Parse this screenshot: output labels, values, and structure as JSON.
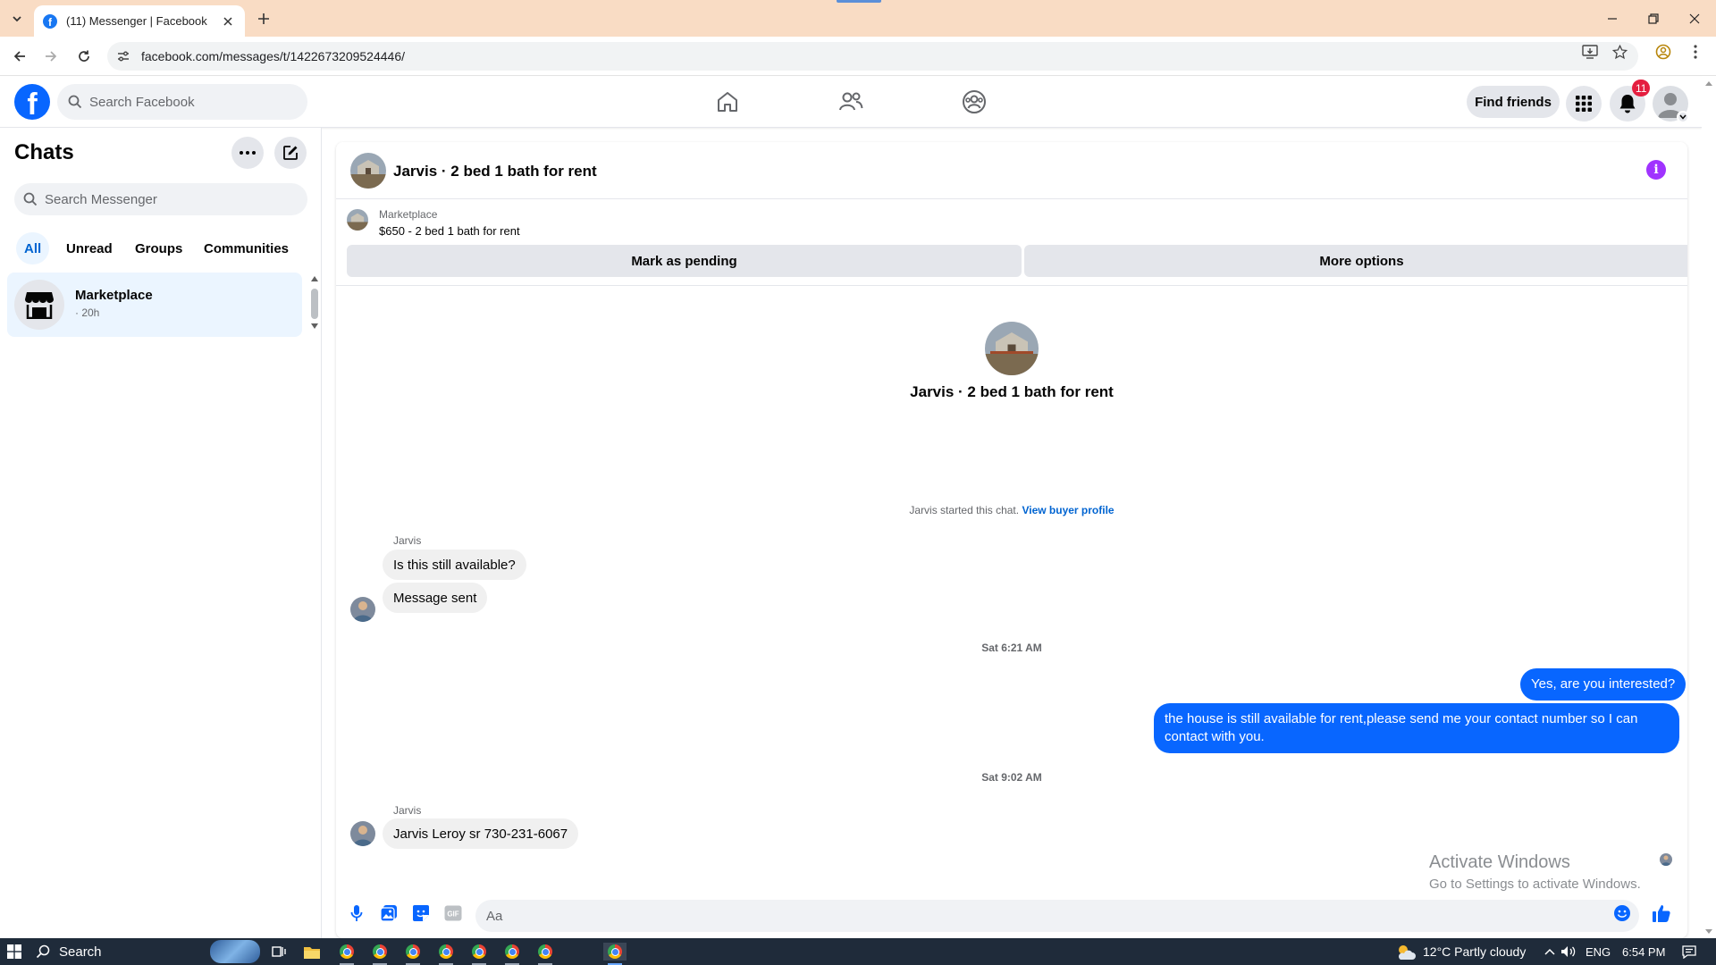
{
  "browser": {
    "tab_title": "(11) Messenger | Facebook",
    "url": "facebook.com/messages/t/1422673209524446/"
  },
  "fb_nav": {
    "search_placeholder": "Search Facebook",
    "find_friends": "Find friends",
    "notification_count": "11"
  },
  "chats_panel": {
    "title": "Chats",
    "search_placeholder": "Search Messenger",
    "filters": [
      "All",
      "Unread",
      "Groups",
      "Communities"
    ],
    "active_filter": "All",
    "items": [
      {
        "name": "Marketplace",
        "time": "· 20h"
      }
    ]
  },
  "conversation": {
    "header_title": "Jarvis · 2 bed 1 bath for rent",
    "marketplace": {
      "label": "Marketplace",
      "item": "$650 - 2 bed 1 bath for rent",
      "mark_pending": "Mark as pending",
      "more_options": "More options"
    },
    "intro_title": "Jarvis · 2 bed 1 bath for rent",
    "started_text": "Jarvis started this chat.",
    "view_profile": "View buyer profile",
    "messages": [
      {
        "sender": "Jarvis",
        "text": "Is this still available?"
      },
      {
        "text": "Message sent"
      },
      {
        "timestamp": "Sat 6:21 AM"
      },
      {
        "text": "Yes, are you interested?"
      },
      {
        "text": "the house is still available for rent,please send me your contact number so I can contact with you."
      },
      {
        "timestamp": "Sat 9:02 AM"
      },
      {
        "sender": "Jarvis",
        "text": "Jarvis Leroy sr 730-231-6067"
      }
    ],
    "composer_placeholder": "Aa"
  },
  "watermark": {
    "line1": "Activate Windows",
    "line2": "Go to Settings to activate Windows."
  },
  "taskbar": {
    "search_label": "Search",
    "weather": "12°C  Partly cloudy",
    "language": "ENG",
    "time": "6:54 PM"
  },
  "colors": {
    "fb_blue": "#0866ff",
    "selected_bg": "#ebf5ff",
    "info_purple": "#a033ff",
    "badge_red": "#e41e3f"
  }
}
